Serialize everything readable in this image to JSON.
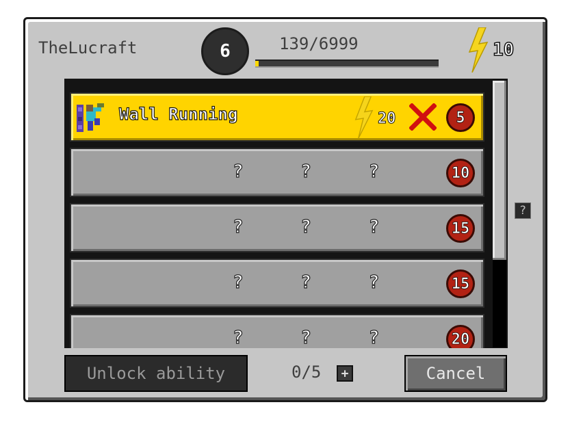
{
  "header": {
    "player_name": "TheLucraft",
    "level": "6",
    "xp_text": "139/6999",
    "xp_progress": 0.02,
    "points": "10"
  },
  "abilities": [
    {
      "name": "Wall Running",
      "cost": "20",
      "required_level": "5",
      "unlocked": true,
      "icon": "wall-running-icon"
    },
    {
      "name": "? ? ?",
      "required_level": "10",
      "unlocked": false
    },
    {
      "name": "? ? ?",
      "required_level": "15",
      "unlocked": false
    },
    {
      "name": "? ? ?",
      "required_level": "15",
      "unlocked": false
    },
    {
      "name": "? ? ?",
      "required_level": "20",
      "unlocked": false
    }
  ],
  "help_label": "?",
  "footer": {
    "unlock_label": "Unlock ability",
    "counter": "0/5",
    "plus_label": "+",
    "cancel_label": "Cancel"
  },
  "colors": {
    "selected_row": "#ffd400",
    "locked_row": "#a0a0a0",
    "badge": "#b22214",
    "lightning": "#f5d520"
  }
}
